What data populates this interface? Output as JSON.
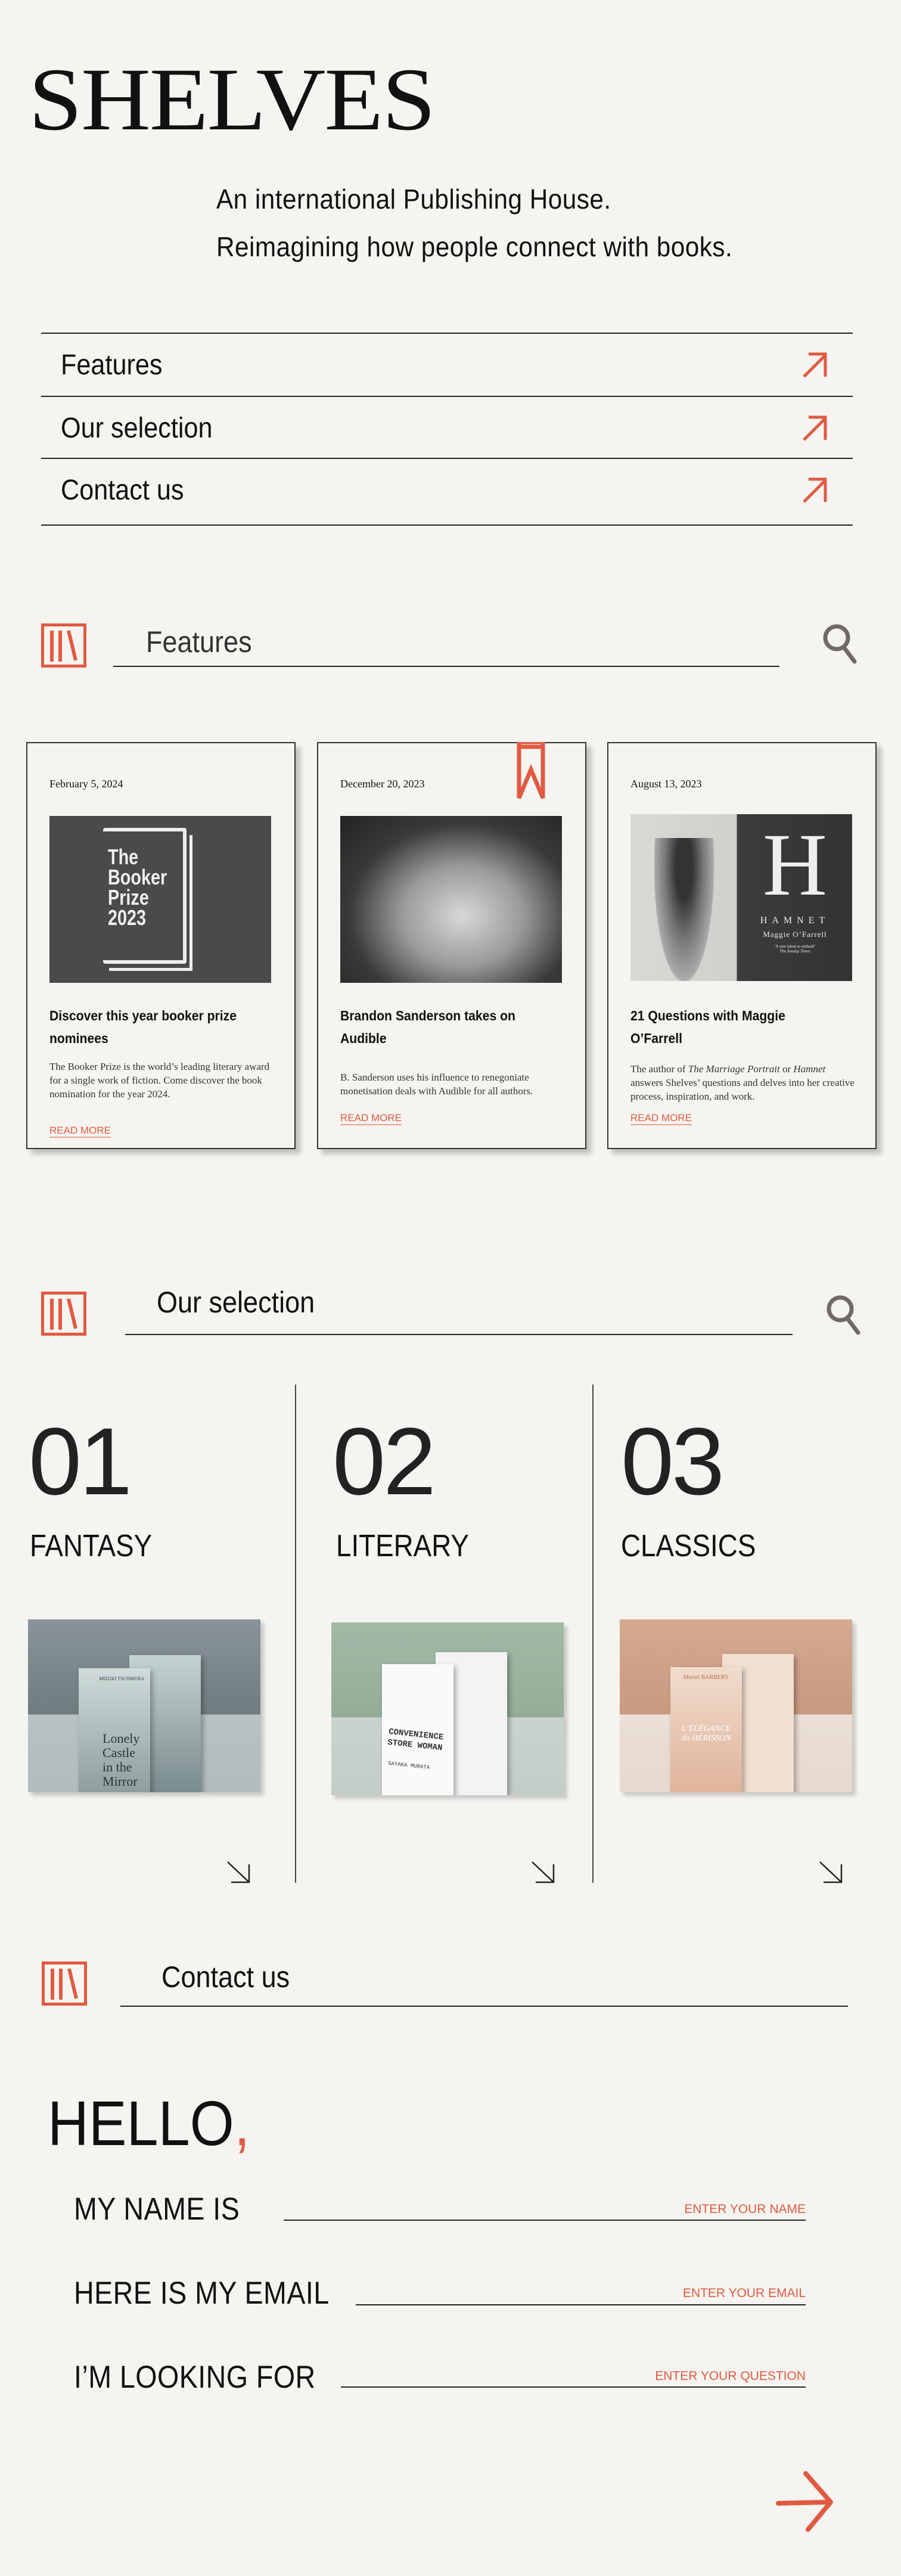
{
  "brand": {
    "logo": "SHELVES",
    "accent": "#e05a42",
    "background": "#f5f4f0"
  },
  "tagline": [
    "An international Publishing House.",
    "Reimagining how people connect with books."
  ],
  "nav": [
    {
      "label": "Features",
      "icon": "arrow-up-right-icon"
    },
    {
      "label": "Our selection",
      "icon": "arrow-up-right-icon"
    },
    {
      "label": "Contact us",
      "icon": "arrow-up-right-icon"
    }
  ],
  "features": {
    "title": "Features",
    "cards": [
      {
        "date": "February 5, 2024",
        "image_text": [
          "The",
          "Booker",
          "Prize",
          "2023"
        ],
        "title": "Discover this year booker prize nominees",
        "body": "The Booker Prize is the world’s leading literary award for a single work of fiction. Come discover the book nomination for the year 2024.",
        "more": "READ MORE"
      },
      {
        "date": "December 20, 2023",
        "title": "Brandon Sanderson takes on Audible",
        "body": "B. Sanderson uses his influence to renegoniate monetisation deals with Audible for all authors.",
        "more": "READ MORE",
        "bookmarked": true
      },
      {
        "date": "August 13, 2023",
        "image_text": {
          "letter": "H",
          "book": "HAMNET",
          "author": "Maggie O’Farrell",
          "quote": "‘A rare talent to enthrall’",
          "source": "The Sunday Times"
        },
        "title": "21 Questions with Maggie O’Farrell",
        "body_parts": [
          "The author of ",
          "The Marriage Portrait",
          " or ",
          "Hamnet",
          " answers Shelves’ questions and delves into her creative process, inspiration, and work."
        ],
        "more": "READ MORE"
      }
    ]
  },
  "selection": {
    "title": "Our selection",
    "columns": [
      {
        "number": "01",
        "category": "FANTASY",
        "book": {
          "author": "MIZUKI TSUJIMURA",
          "title": "Lonely Castle in the Mirror"
        }
      },
      {
        "number": "02",
        "category": "LITERARY",
        "book": {
          "author": "SAYAKA MURATA",
          "title": "CONVENIENCE STORE WOMAN"
        }
      },
      {
        "number": "03",
        "category": "CLASSICS",
        "book": {
          "author": "Muriel BARBERY",
          "title": "L’ÉLÉGANCE du HÉRISSON"
        }
      }
    ]
  },
  "contact": {
    "title": "Contact us",
    "greeting": "HELLO",
    "comma": ",",
    "fields": [
      {
        "label": "MY NAME IS",
        "placeholder": "ENTER YOUR NAME"
      },
      {
        "label": "HERE IS MY EMAIL",
        "placeholder": "ENTER YOUR EMAIL"
      },
      {
        "label": "I’M LOOKING FOR",
        "placeholder": "ENTER YOUR QUESTION"
      }
    ]
  }
}
